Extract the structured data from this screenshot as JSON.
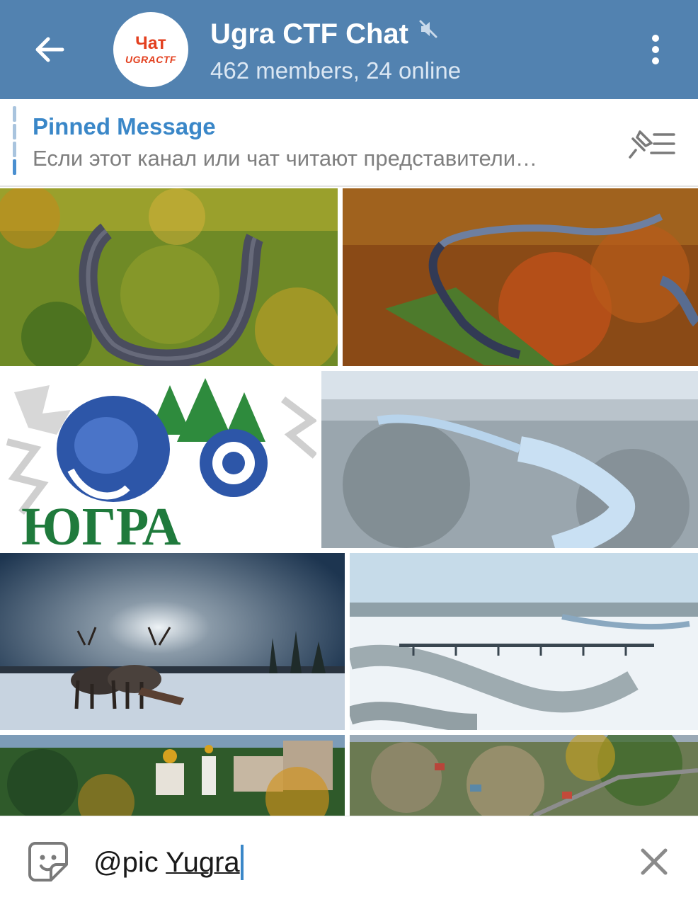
{
  "header": {
    "title": "Ugra CTF Chat",
    "subtitle": "462 members, 24 online",
    "avatar_line1": "Чат",
    "avatar_line2": "UGRACTF",
    "muted": true,
    "back_icon": "arrow-left-icon",
    "more_icon": "more-vertical-icon",
    "accent_color": "#5282b0"
  },
  "pinned": {
    "title": "Pinned Message",
    "text": "Если этот канал или чат читают представители…",
    "icon": "pin-list-icon"
  },
  "results": {
    "items": [
      {
        "name": "photo-river-bend-autumn"
      },
      {
        "name": "photo-river-autumn-forest"
      },
      {
        "name": "photo-ugra-logo"
      },
      {
        "name": "photo-winter-river"
      },
      {
        "name": "photo-reindeer-sunset"
      },
      {
        "name": "photo-bridge-frozen-river"
      },
      {
        "name": "photo-church-city"
      },
      {
        "name": "photo-town-aerial"
      }
    ],
    "logo_text": "ЮГРА"
  },
  "input": {
    "prefix": "@pic ",
    "query": "Yugra",
    "sticker_icon": "sticker-icon",
    "clear_icon": "close-icon"
  }
}
